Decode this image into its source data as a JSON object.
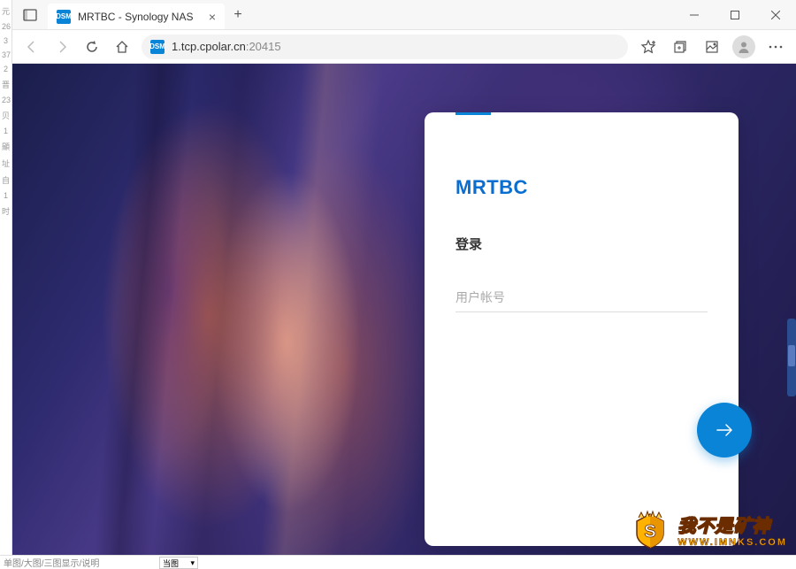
{
  "browser": {
    "tab_title": "MRTBC - Synology NAS",
    "tab_favicon_label": "DSM",
    "url_host": "1.tcp.cpolar.cn",
    "url_port": ":20415",
    "url_favicon_label": "DSM"
  },
  "login": {
    "brand": "MRTBC",
    "title": "登录",
    "username_placeholder": "用户帐号"
  },
  "watermark": {
    "cn_text": "我不是矿神",
    "url_text": "WWW.IMNKS.COM"
  },
  "left_strip_items": [
    "元",
    "26",
    "3",
    "37",
    "2",
    "晋",
    "23",
    "贝",
    "1",
    "顯",
    "址",
    "自",
    "1",
    "时"
  ],
  "bottom_text": "单图/大图/三图显示/说明",
  "bottom_dropdown": "当图"
}
